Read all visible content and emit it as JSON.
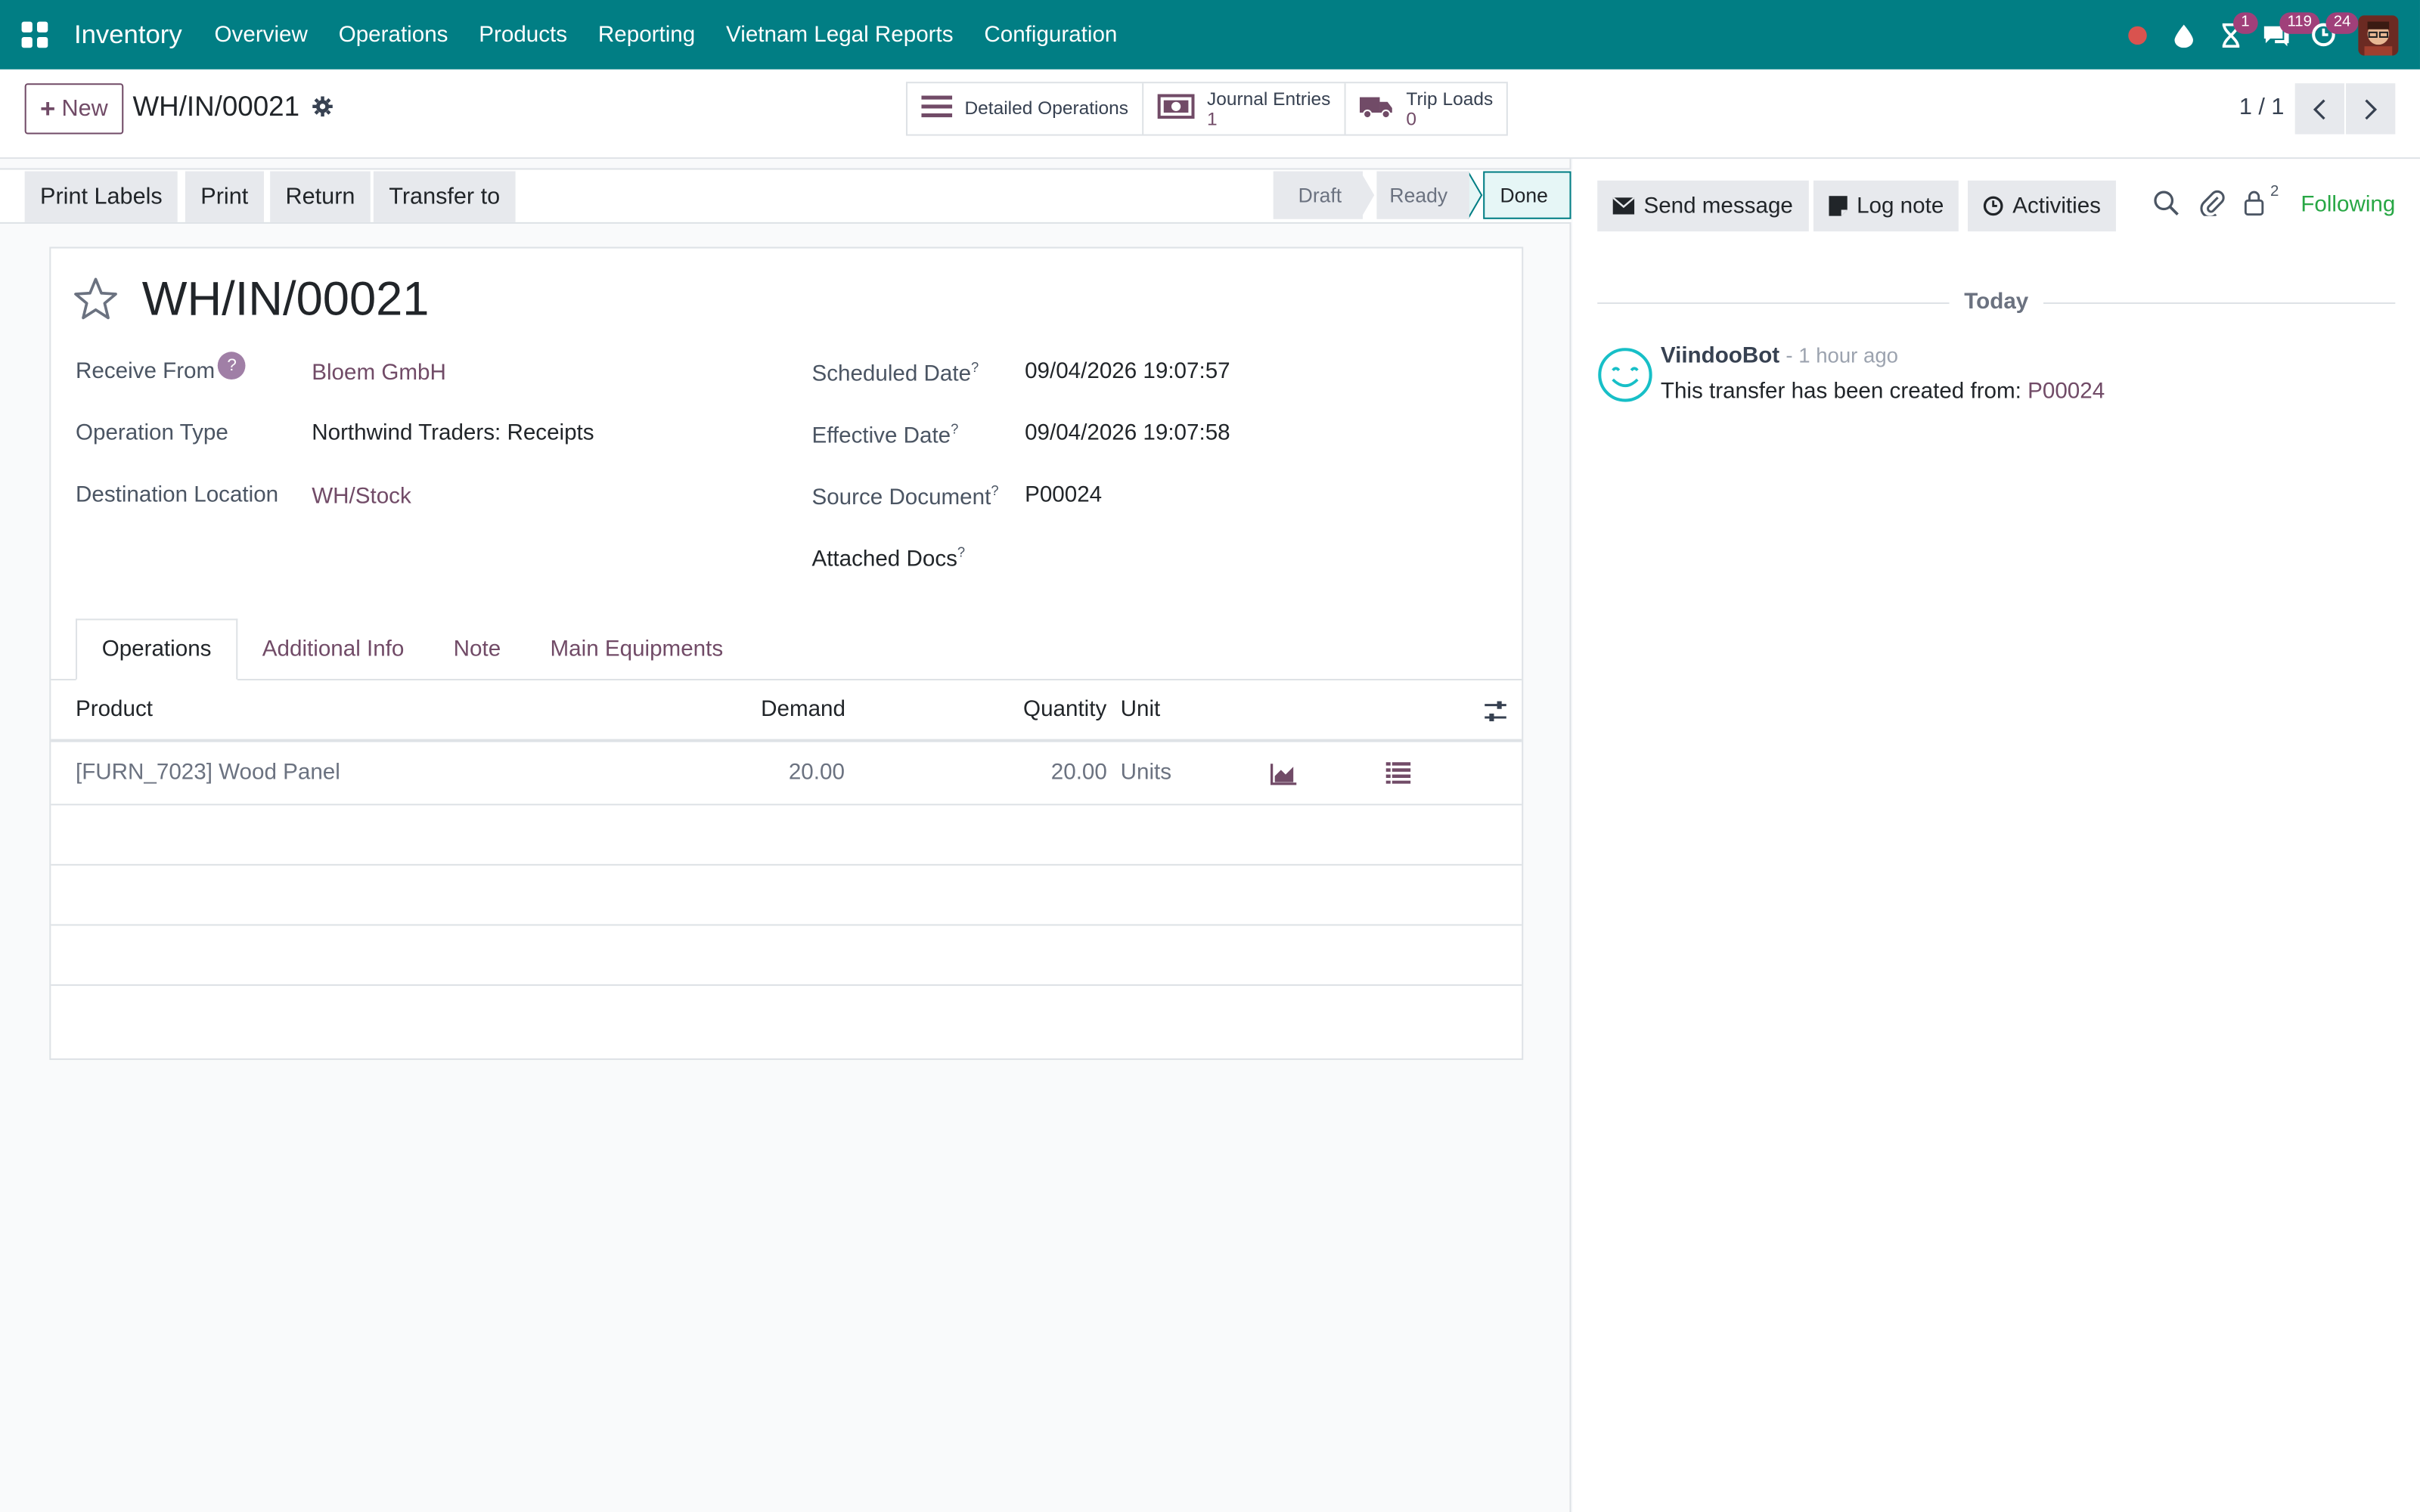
{
  "navbar": {
    "brand": "Inventory",
    "menu": [
      "Overview",
      "Operations",
      "Products",
      "Reporting",
      "Vietnam Legal Reports",
      "Configuration"
    ],
    "badges": {
      "activities": "1",
      "messages": "119",
      "updates": "24"
    }
  },
  "control": {
    "new_label": "New",
    "record_name": "WH/IN/00021",
    "smart_buttons": [
      {
        "label": "Detailed Operations",
        "count": "",
        "icon": "list-icon"
      },
      {
        "label": "Journal Entries",
        "count": "1",
        "icon": "money-icon"
      },
      {
        "label": "Trip Loads",
        "count": "0",
        "icon": "truck-icon"
      }
    ],
    "pager": "1 / 1"
  },
  "statusbar": {
    "actions": [
      "Print Labels",
      "Print",
      "Return",
      "Transfer to"
    ],
    "stages": [
      "Draft",
      "Ready",
      "Done"
    ],
    "current_stage": "Done"
  },
  "form": {
    "title": "WH/IN/00021",
    "receive_from_label": "Receive From",
    "receive_from_value": "Bloem GmbH",
    "operation_type_label": "Operation Type",
    "operation_type_value": "Northwind Traders: Receipts",
    "destination_label": "Destination Location",
    "destination_value": "WH/Stock",
    "scheduled_label": "Scheduled Date",
    "scheduled_value": "09/04/2026 19:07:57",
    "effective_label": "Effective Date",
    "effective_value": "09/04/2026 19:07:58",
    "source_label": "Source Document",
    "source_value": "P00024",
    "attached_label": "Attached Docs",
    "help_mark": "?",
    "tabs": [
      "Operations",
      "Additional Info",
      "Note",
      "Main Equipments"
    ],
    "table": {
      "headers": {
        "product": "Product",
        "demand": "Demand",
        "quantity": "Quantity",
        "unit": "Unit"
      },
      "rows": [
        {
          "product": "[FURN_7023] Wood Panel",
          "demand": "20.00",
          "quantity": "20.00",
          "unit": "Units"
        }
      ]
    }
  },
  "chatter": {
    "send_message": "Send message",
    "log_note": "Log note",
    "activities": "Activities",
    "followers_count": "2",
    "following": "Following",
    "today": "Today",
    "message": {
      "author": "ViindooBot",
      "time": "- 1 hour ago",
      "body": "This transfer has been created from:",
      "link": "P00024"
    }
  },
  "colors": {
    "navbar": "#017e84",
    "accent": "#714b67",
    "following": "#28a745"
  }
}
